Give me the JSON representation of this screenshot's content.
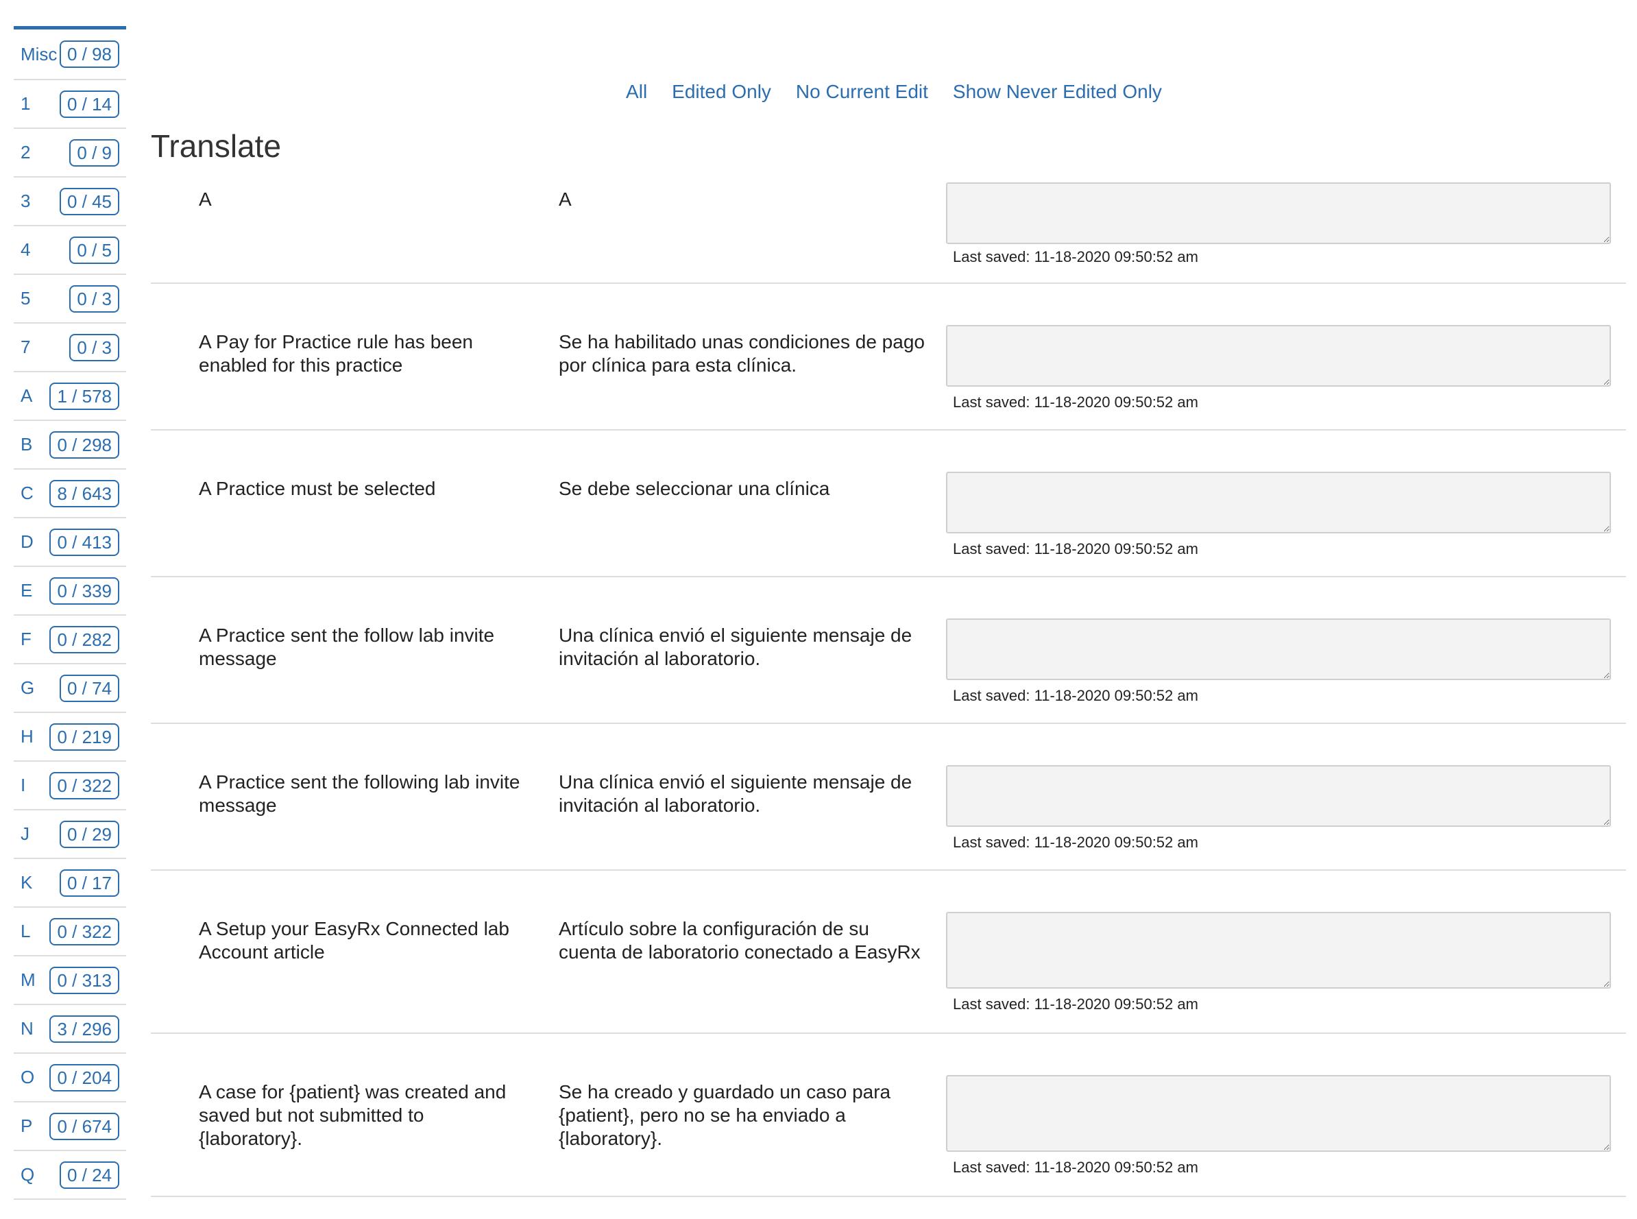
{
  "sidebar": {
    "items": [
      {
        "letter": "Misc",
        "count": "0 / 98"
      },
      {
        "letter": "1",
        "count": "0 / 14"
      },
      {
        "letter": "2",
        "count": "0 / 9"
      },
      {
        "letter": "3",
        "count": "0 / 45"
      },
      {
        "letter": "4",
        "count": "0 / 5"
      },
      {
        "letter": "5",
        "count": "0 / 3"
      },
      {
        "letter": "7",
        "count": "0 / 3"
      },
      {
        "letter": "A",
        "count": "1 / 578"
      },
      {
        "letter": "B",
        "count": "0 / 298"
      },
      {
        "letter": "C",
        "count": "8 / 643"
      },
      {
        "letter": "D",
        "count": "0 / 413"
      },
      {
        "letter": "E",
        "count": "0 / 339"
      },
      {
        "letter": "F",
        "count": "0 / 282"
      },
      {
        "letter": "G",
        "count": "0 / 74"
      },
      {
        "letter": "H",
        "count": "0 / 219"
      },
      {
        "letter": "I",
        "count": "0 / 322"
      },
      {
        "letter": "J",
        "count": "0 / 29"
      },
      {
        "letter": "K",
        "count": "0 / 17"
      },
      {
        "letter": "L",
        "count": "0 / 322"
      },
      {
        "letter": "M",
        "count": "0 / 313"
      },
      {
        "letter": "N",
        "count": "3 / 296"
      },
      {
        "letter": "O",
        "count": "0 / 204"
      },
      {
        "letter": "P",
        "count": "0 / 674"
      },
      {
        "letter": "Q",
        "count": "0 / 24"
      }
    ]
  },
  "filters": {
    "all": "All",
    "edited_only": "Edited Only",
    "no_current_edit": "No Current Edit",
    "never_edited": "Show Never Edited Only"
  },
  "page_title": "Translate",
  "rows": [
    {
      "source": "A",
      "translation": "A",
      "edit_value": "",
      "saved": "Last saved: 11-18-2020 09:50:52 am"
    },
    {
      "source": "A Pay for Practice rule has been enabled for this practice",
      "translation": "Se ha habilitado unas condiciones de pago por clínica para esta clínica.",
      "edit_value": "",
      "saved": "Last saved: 11-18-2020 09:50:52 am"
    },
    {
      "source": "A Practice must be selected",
      "translation": "Se debe seleccionar una clínica",
      "edit_value": "",
      "saved": "Last saved: 11-18-2020 09:50:52 am"
    },
    {
      "source": "A Practice sent the follow lab invite message",
      "translation": "Una clínica envió el siguiente mensaje de invitación al laboratorio.",
      "edit_value": "",
      "saved": "Last saved: 11-18-2020 09:50:52 am"
    },
    {
      "source": "A Practice sent the following lab invite message",
      "translation": "Una clínica envió el siguiente mensaje de invitación al laboratorio.",
      "edit_value": "",
      "saved": "Last saved: 11-18-2020 09:50:52 am"
    },
    {
      "source": "A Setup your EasyRx Connected lab Account article",
      "translation": "Artículo sobre la configuración de su cuenta de laboratorio conectado a EasyRx",
      "edit_value": "",
      "saved": "Last saved: 11-18-2020 09:50:52 am"
    },
    {
      "source": "A case for {patient} was created and saved but not submitted to {laboratory}.",
      "translation": "Se ha creado y guardado un caso para {patient}, pero no se ha enviado a {laboratory}.",
      "edit_value": "",
      "saved": "Last saved: 11-18-2020 09:50:52 am"
    }
  ]
}
